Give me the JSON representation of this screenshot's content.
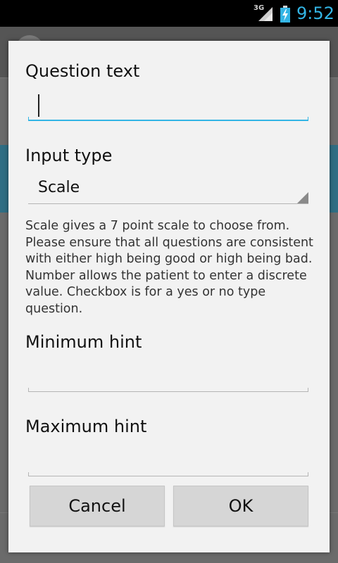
{
  "status_bar": {
    "network": "3G",
    "time": "9:52",
    "signal_icon": "signal-icon",
    "battery_icon": "battery-charging-icon",
    "accent_color": "#33b5e5"
  },
  "dialog": {
    "question_text_label": "Question text",
    "question_text_value": "",
    "input_type_label": "Input type",
    "input_type_selected": "Scale",
    "description": "Scale gives a 7 point scale to choose from. Please ensure that all questions are consistent with either high being good or high being bad. Number allows the patient to enter a discrete value. Checkbox is for a yes or no type question.",
    "minimum_hint_label": "Minimum hint",
    "minimum_hint_value": "",
    "maximum_hint_label": "Maximum hint",
    "maximum_hint_value": "",
    "cancel_label": "Cancel",
    "ok_label": "OK"
  }
}
